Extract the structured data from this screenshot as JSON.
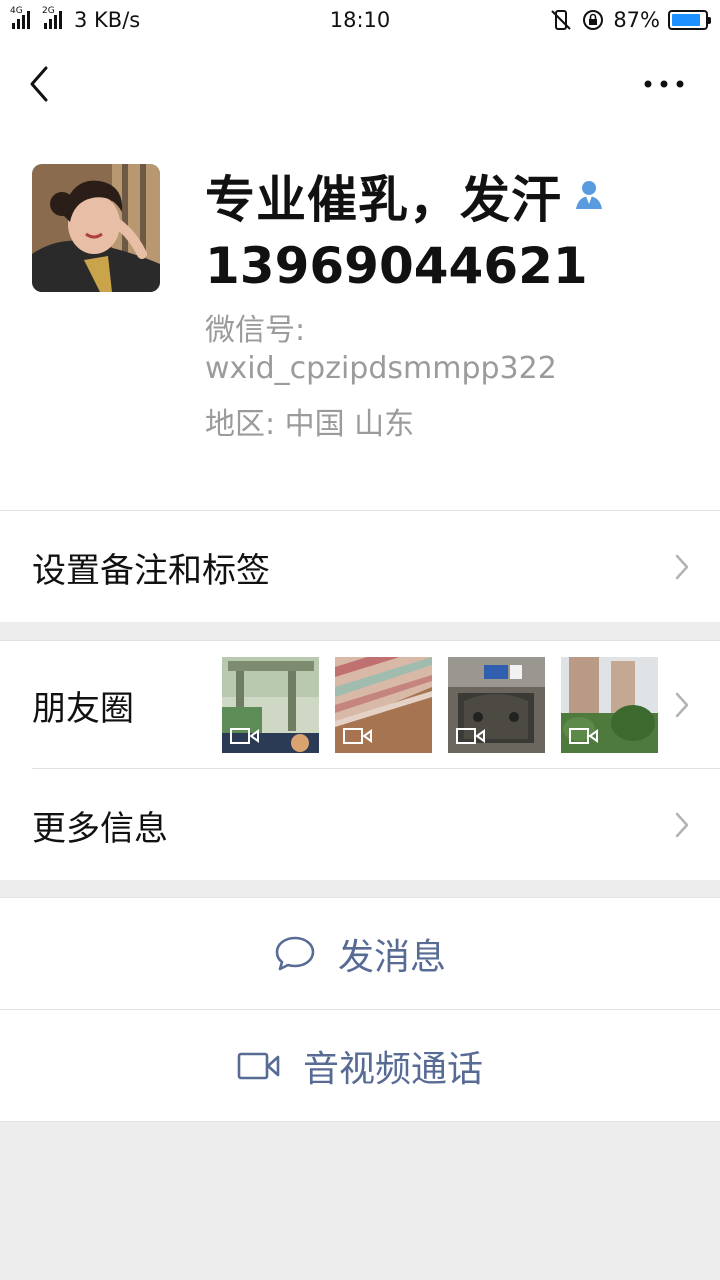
{
  "status_bar": {
    "network_speed": "3 KB/s",
    "time": "18:10",
    "battery_percent": "87%",
    "battery_level": 0.87,
    "signal_labels": [
      "4G",
      "2G"
    ]
  },
  "nav": {
    "back_icon": "chevron-left-icon",
    "more_icon": "more-dots-icon"
  },
  "profile": {
    "nickname": "专业催乳，发汗",
    "phone": "13969044621",
    "wxid_label": "微信号:",
    "wxid": "wxid_cpzipdsmmpp322",
    "region": "地区: 中国  山东",
    "gender_icon": "person-icon"
  },
  "menu": {
    "remark_label": "设置备注和标签",
    "moments_label": "朋友圈",
    "more_info_label": "更多信息"
  },
  "actions": {
    "message_label": "发消息",
    "call_label": "音视频通话"
  },
  "colors": {
    "link": "#576b95",
    "secondary_text": "#9b9b9b",
    "background": "#ededed"
  }
}
